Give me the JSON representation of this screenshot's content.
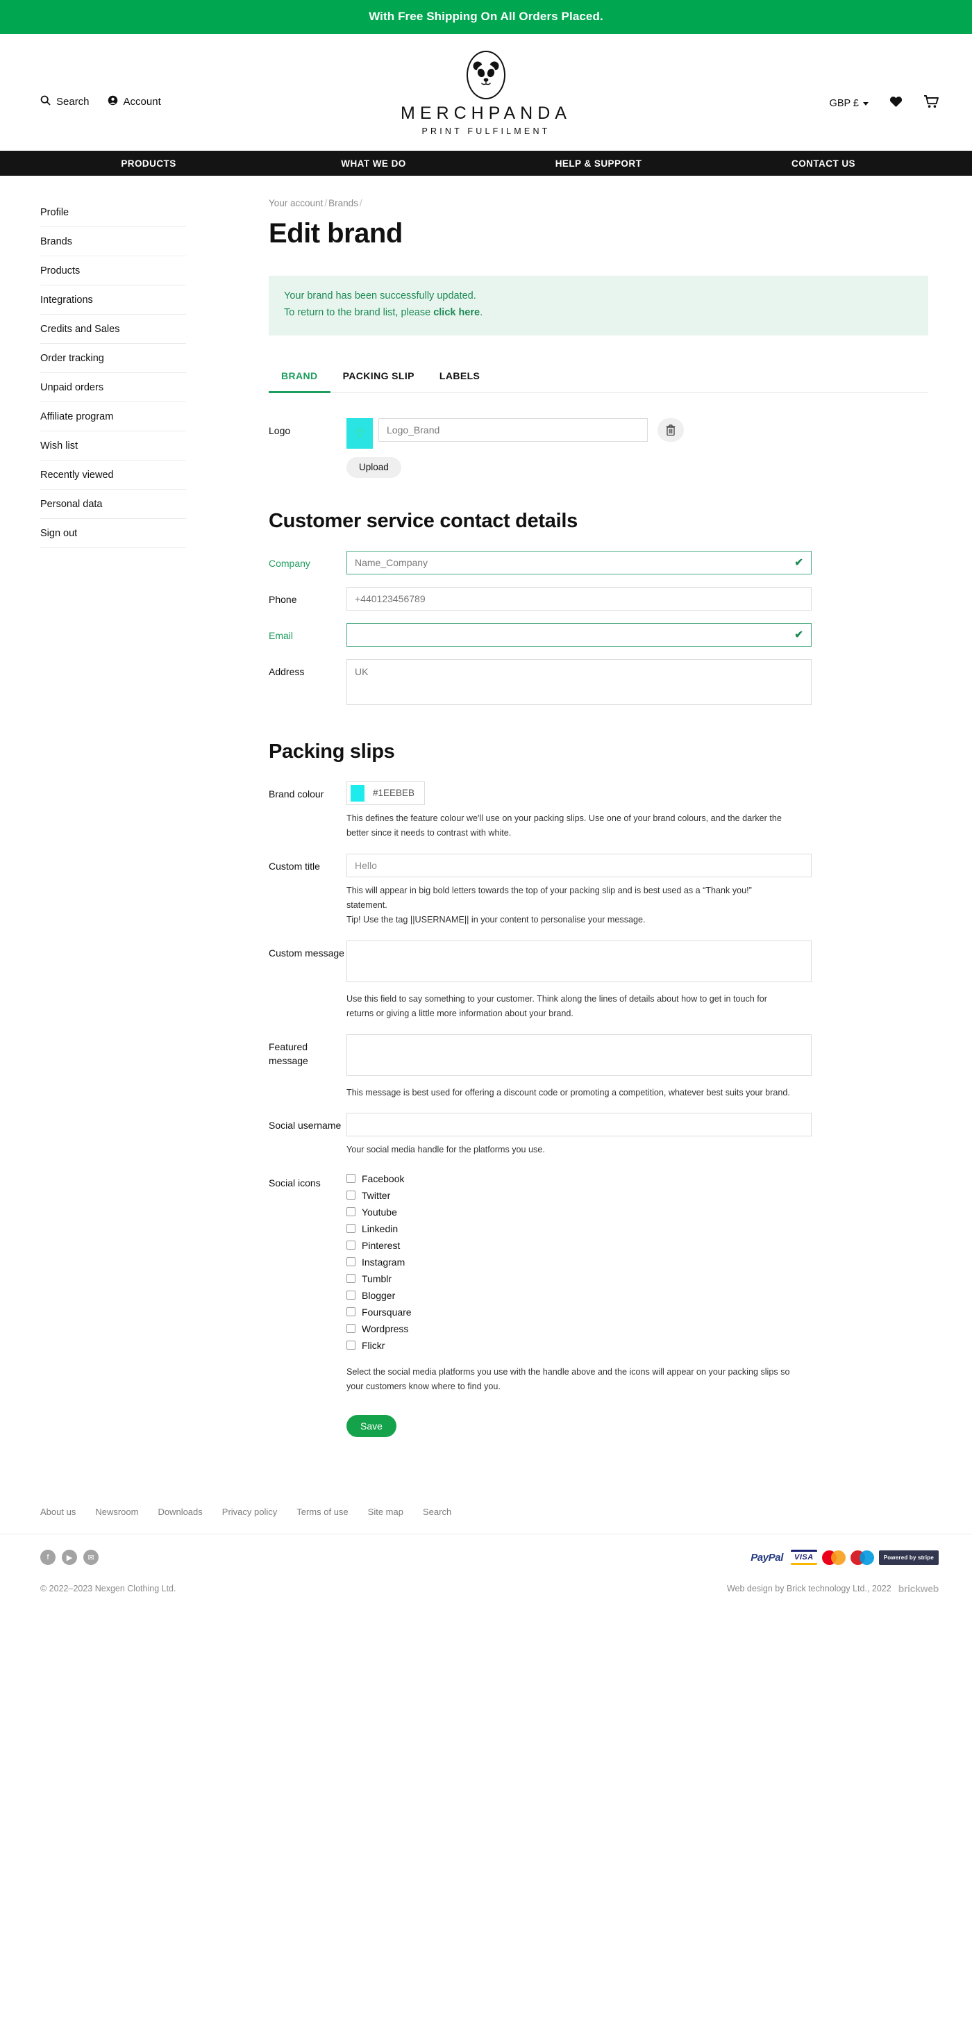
{
  "announcement": {
    "text": "With Free Shipping On All Orders Placed."
  },
  "brand": {
    "name": "MERCHPANDA",
    "tagline": "PRINT FULFILMENT",
    "logo_icon": "panda-logo-icon"
  },
  "masthead": {
    "search_label": "Search",
    "search_icon": "search-icon",
    "account_label": "Account",
    "account_icon": "user-circle-icon",
    "currency_label": "GBP £",
    "currency_caret_icon": "chevron-down-icon",
    "wishlist_icon": "heart-icon",
    "cart_icon": "shopping-cart-icon"
  },
  "mainnav": {
    "items": [
      {
        "label": "PRODUCTS"
      },
      {
        "label": "WHAT WE DO"
      },
      {
        "label": "HELP & SUPPORT"
      },
      {
        "label": "CONTACT US"
      }
    ]
  },
  "sidebar": {
    "items": [
      {
        "label": "Profile"
      },
      {
        "label": "Brands"
      },
      {
        "label": "Products"
      },
      {
        "label": "Integrations"
      },
      {
        "label": "Credits and Sales"
      },
      {
        "label": "Order tracking"
      },
      {
        "label": "Unpaid orders"
      },
      {
        "label": "Affiliate program"
      },
      {
        "label": "Wish list"
      },
      {
        "label": "Recently viewed"
      },
      {
        "label": "Personal data"
      },
      {
        "label": "Sign out"
      }
    ]
  },
  "breadcrumb": {
    "item1": "Your account",
    "sep1": "/",
    "item2": "Brands",
    "sep2": "/"
  },
  "page": {
    "title": "Edit brand"
  },
  "alert": {
    "line1": "Your brand has been successfully updated.",
    "line2_prefix": "To return to the brand list, please ",
    "line2_link": "click here",
    "line2_suffix": "."
  },
  "tabs": [
    {
      "label": "BRAND",
      "active": true
    },
    {
      "label": "PACKING SLIP",
      "active": false
    },
    {
      "label": "LABELS",
      "active": false
    }
  ],
  "logo": {
    "label": "Logo",
    "filename_value": "Logo_Brand",
    "swatch_color": "#2AE3E3",
    "heart_icon": "heart-outline-icon",
    "delete_icon": "trash-icon",
    "upload_label": "Upload"
  },
  "contact_section": {
    "heading": "Customer service contact details",
    "company_label": "Company",
    "company_value": "Name_Company",
    "company_valid_icon": "check-icon",
    "phone_label": "Phone",
    "phone_value": "+440123456789",
    "email_label": "Email",
    "email_value": "",
    "email_valid_icon": "check-icon",
    "address_label": "Address",
    "address_value": "UK"
  },
  "packing_section": {
    "heading": "Packing slips",
    "brand_colour_label": "Brand colour",
    "brand_colour_value": "#1EEBEB",
    "brand_colour_help": "This defines the feature colour we'll use on your packing slips. Use one of your brand colours, and the darker the better since it needs to contrast with white.",
    "custom_title_label": "Custom title",
    "custom_title_value": "Hello",
    "custom_title_help_1": "This will appear in big bold letters towards the top of your packing slip and is best used as a “Thank you!” statement.",
    "custom_title_help_2": "Tip! Use the tag ||USERNAME|| in your content to personalise your message.",
    "custom_message_label": "Custom message",
    "custom_message_value": "",
    "custom_message_help": "Use this field to say something to your customer. Think along the lines of details about how to get in touch for returns or giving a little more information about your brand.",
    "featured_message_label": "Featured message",
    "featured_message_value": "",
    "featured_message_help": "This message is best used for offering a discount code or promoting a competition, whatever best suits your brand.",
    "social_username_label": "Social username",
    "social_username_value": "",
    "social_username_help": "Your social media handle for the platforms you use.",
    "social_icons_label": "Social icons",
    "social_icons_help": "Select the social media platforms you use with the handle above and the icons will appear on your packing slips so your customers know where to find you.",
    "social_platforms": [
      {
        "label": "Facebook",
        "checked": false
      },
      {
        "label": "Twitter",
        "checked": false
      },
      {
        "label": "Youtube",
        "checked": false
      },
      {
        "label": "Linkedin",
        "checked": false
      },
      {
        "label": "Pinterest",
        "checked": false
      },
      {
        "label": "Instagram",
        "checked": false
      },
      {
        "label": "Tumblr",
        "checked": false
      },
      {
        "label": "Blogger",
        "checked": false
      },
      {
        "label": "Foursquare",
        "checked": false
      },
      {
        "label": "Wordpress",
        "checked": false
      },
      {
        "label": "Flickr",
        "checked": false
      }
    ]
  },
  "save_button": {
    "label": "Save"
  },
  "footer": {
    "links": [
      {
        "label": "About us"
      },
      {
        "label": "Newsroom"
      },
      {
        "label": "Downloads"
      },
      {
        "label": "Privacy policy"
      },
      {
        "label": "Terms of use"
      },
      {
        "label": "Site map"
      },
      {
        "label": "Search"
      }
    ],
    "social": [
      {
        "icon": "facebook-icon",
        "glyph": "f"
      },
      {
        "icon": "youtube-icon",
        "glyph": "▶"
      },
      {
        "icon": "email-icon",
        "glyph": "✉"
      }
    ],
    "payments": [
      {
        "name": "paypal-logo",
        "label": "PayPal"
      },
      {
        "name": "visa-logo",
        "label": "VISA"
      },
      {
        "name": "mastercard-logo",
        "label": ""
      },
      {
        "name": "maestro-logo",
        "label": ""
      },
      {
        "name": "stripe-logo",
        "label": "Powered by stripe"
      }
    ],
    "copyright": "© 2022–2023 Nexgen Clothing Ltd.",
    "credit": "Web design by Brick technology Ltd., 2022",
    "credit_logo": "brickweb"
  },
  "colors": {
    "accent_green": "#00a650",
    "tab_green": "#1d9d5e",
    "alert_bg": "#e8f5ee",
    "nav_black": "#141414"
  }
}
